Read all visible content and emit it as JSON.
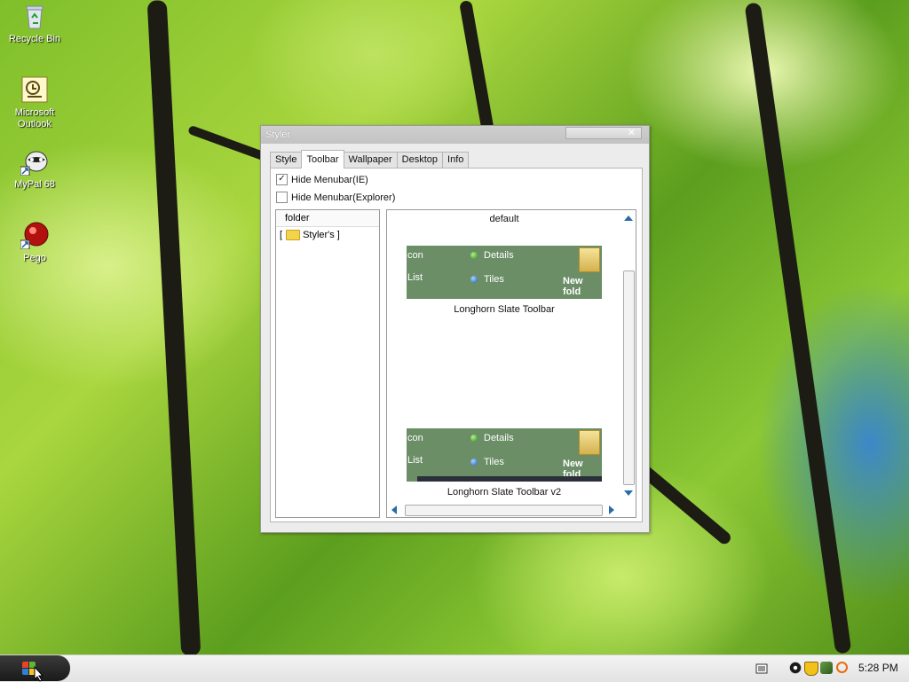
{
  "desktop": {
    "icons": [
      {
        "label": "Recycle Bin",
        "icon": "recycle-bin-icon"
      },
      {
        "label": "Microsoft Outlook",
        "icon": "outlook-icon"
      },
      {
        "label": "MyPal 68",
        "icon": "mypal-icon"
      },
      {
        "label": "Pego",
        "icon": "pego-icon"
      }
    ]
  },
  "window": {
    "title": "Styler",
    "close_glyph": "✕",
    "tabs": [
      "Style",
      "Toolbar",
      "Wallpaper",
      "Desktop",
      "Info"
    ],
    "active_tab": "Toolbar",
    "options": [
      {
        "label": "Hide Menubar(IE)",
        "checked": true
      },
      {
        "label": "Hide Menubar(Explorer)",
        "checked": false
      }
    ],
    "folder_pane": {
      "header": "folder",
      "items": [
        "Styler's"
      ]
    },
    "list_pane": {
      "default_label": "default",
      "items": [
        {
          "name": "Longhorn Slate Toolbar",
          "preview": {
            "left_top": "con",
            "left_bottom": "List",
            "details": "Details",
            "tiles": "Tiles",
            "new_folder": "New fold"
          }
        },
        {
          "name": "Longhorn Slate Toolbar v2",
          "preview": {
            "left_top": "con",
            "left_bottom": "List",
            "details": "Details",
            "tiles": "Tiles",
            "new_folder": "New fold"
          }
        }
      ]
    }
  },
  "taskbar": {
    "clock": "5:28 PM",
    "tray_icons": [
      "network-icon",
      "shield-icon",
      "security-icon",
      "search-icon"
    ]
  },
  "colors": {
    "preview_bg": "#6b8e67",
    "scroll_arrow": "#2a6aa8"
  }
}
